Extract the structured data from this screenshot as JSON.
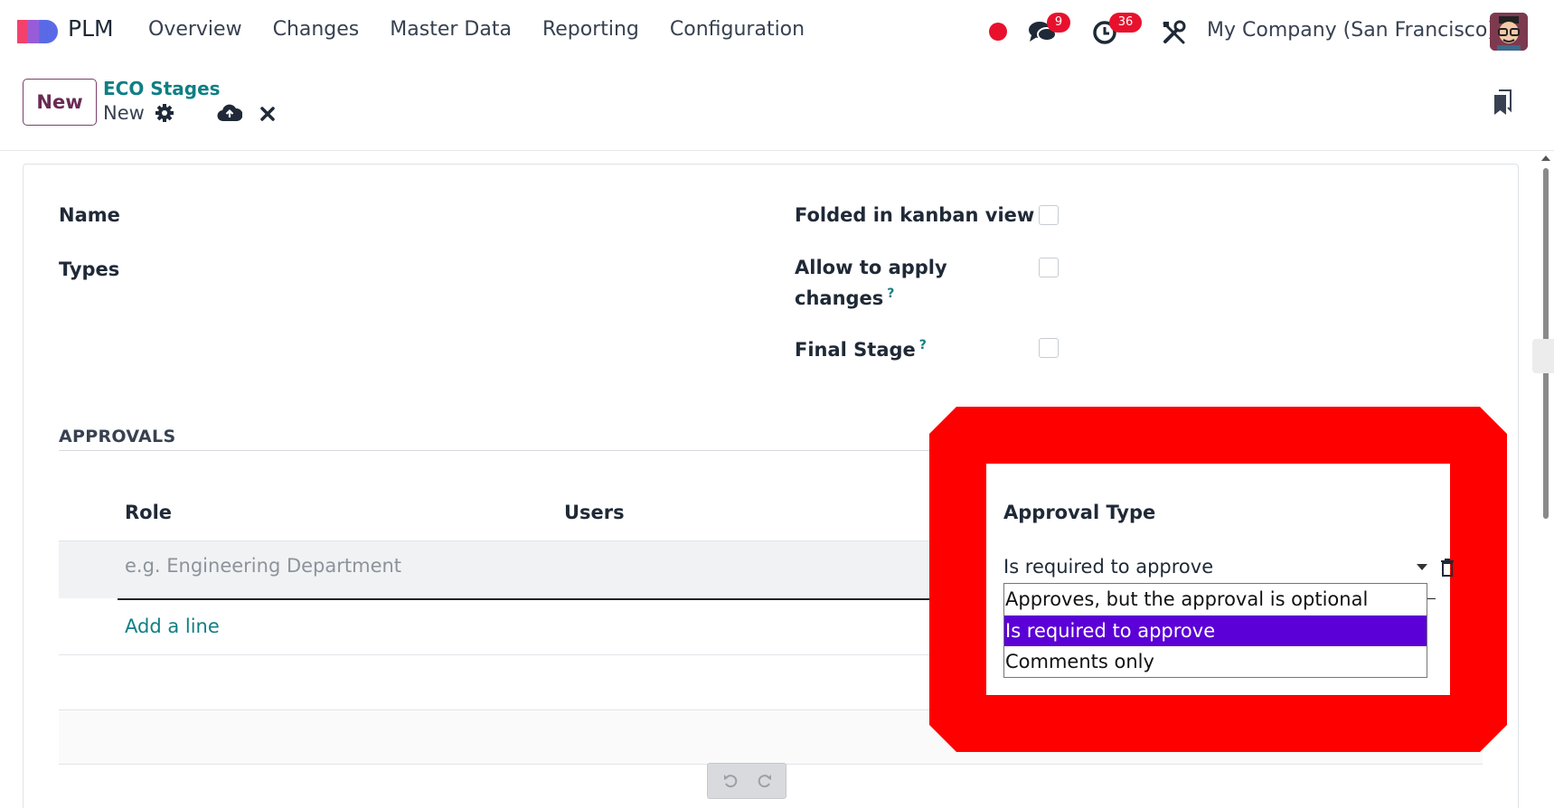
{
  "navbar": {
    "app_name": "PLM",
    "menu": [
      "Overview",
      "Changes",
      "Master Data",
      "Reporting",
      "Configuration"
    ],
    "chat_count": "9",
    "activity_count": "36",
    "company": "My Company (San Francisco)",
    "icons": [
      "recording-dot-icon",
      "chat-icon",
      "clock-icon",
      "tools-icon",
      "avatar"
    ]
  },
  "control_panel": {
    "new_button": "New",
    "breadcrumb_parent": "ECO Stages",
    "breadcrumb_current": "New"
  },
  "form": {
    "name_label": "Name",
    "types_label": "Types",
    "folded_label": "Folded in kanban view",
    "allow_label_1": "Allow to apply",
    "allow_label_2": "changes",
    "final_label": "Final Stage",
    "help_mark": "?",
    "folded_checked": false,
    "allow_checked": false,
    "final_checked": false
  },
  "approvals": {
    "section_title": "APPROVALS",
    "columns": {
      "role": "Role",
      "users": "Users",
      "approval_type": "Approval Type"
    },
    "role_placeholder": "e.g. Engineering Department",
    "approval_value": "Is required to approve",
    "add_line": "Add a line",
    "options": [
      "Approves, but the approval is optional",
      "Is required to approve",
      "Comments only"
    ],
    "selected_option": 1
  },
  "colors": {
    "accent_teal": "#0f7f84",
    "brand_purple": "#6a2b54",
    "badge_red": "#e8112d",
    "highlight_red": "#ff0000",
    "selected_option": "#5b00d6"
  }
}
